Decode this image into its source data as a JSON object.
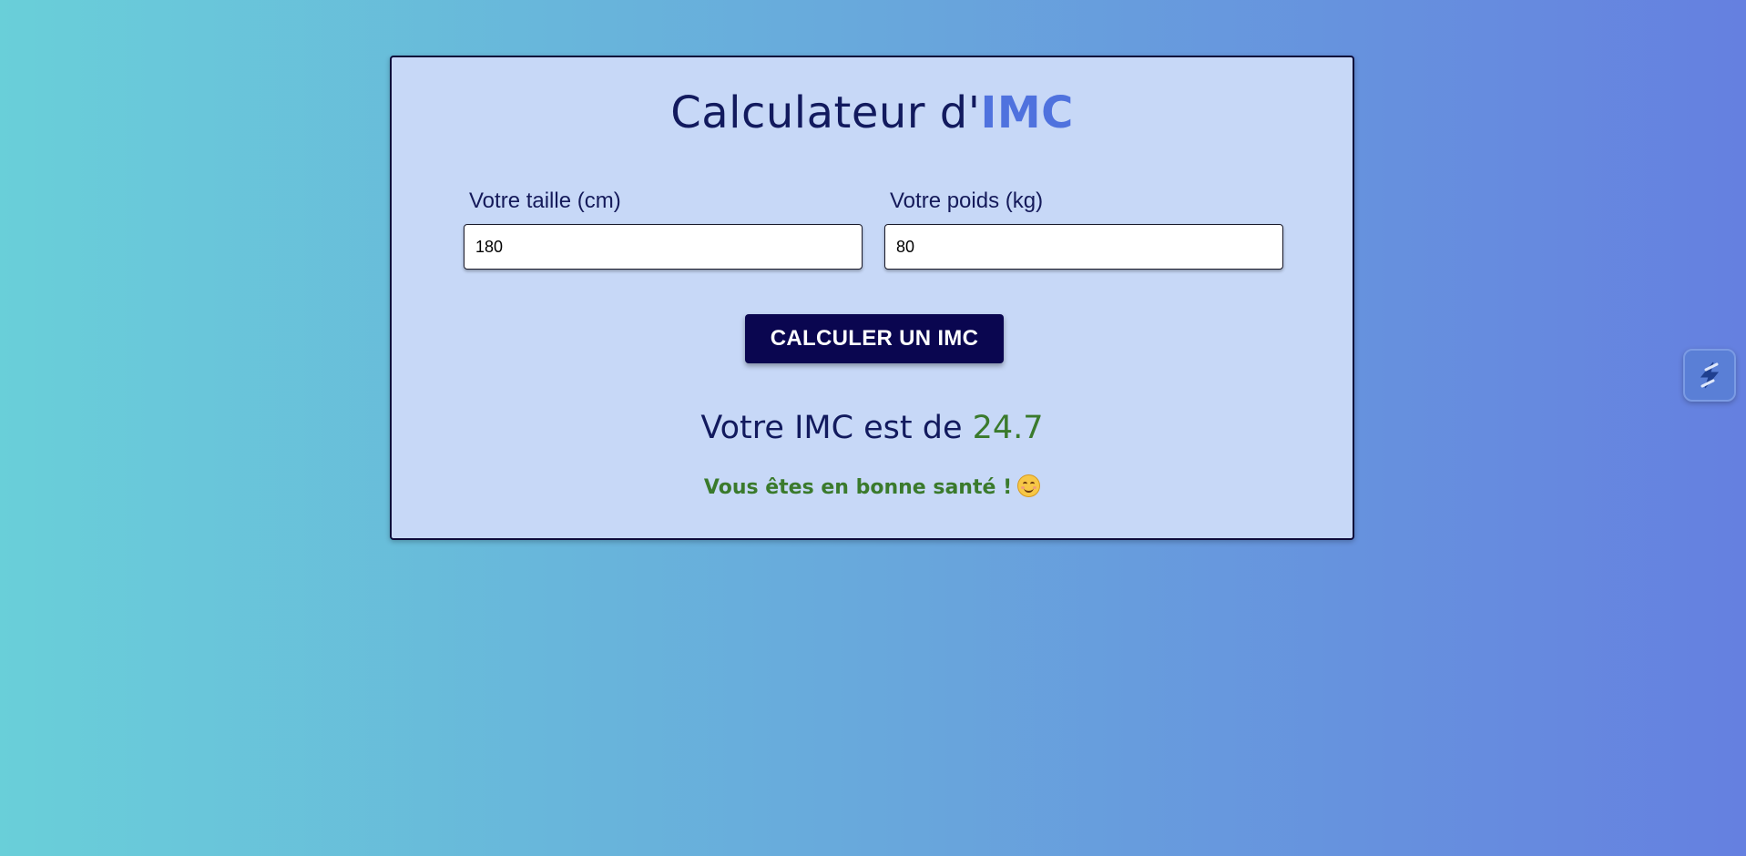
{
  "title": {
    "prefix": "Calculateur d'",
    "accent": "IMC"
  },
  "form": {
    "height": {
      "label": "Votre taille (cm)",
      "value": "180"
    },
    "weight": {
      "label": "Votre poids (kg)",
      "value": "80"
    },
    "submit_label": "CALCULER UN IMC"
  },
  "result": {
    "prefix": "Votre IMC est de ",
    "value": "24.7",
    "message": "Vous êtes en bonne santé !",
    "emoji_icon": "smiling-face-icon"
  },
  "extension": {
    "icon": "lightning-bolt-icon"
  },
  "colors": {
    "accent": "#4f72de",
    "healthy": "#3a7a2c",
    "button": "#0a0650",
    "card": "#c7d8f7"
  }
}
